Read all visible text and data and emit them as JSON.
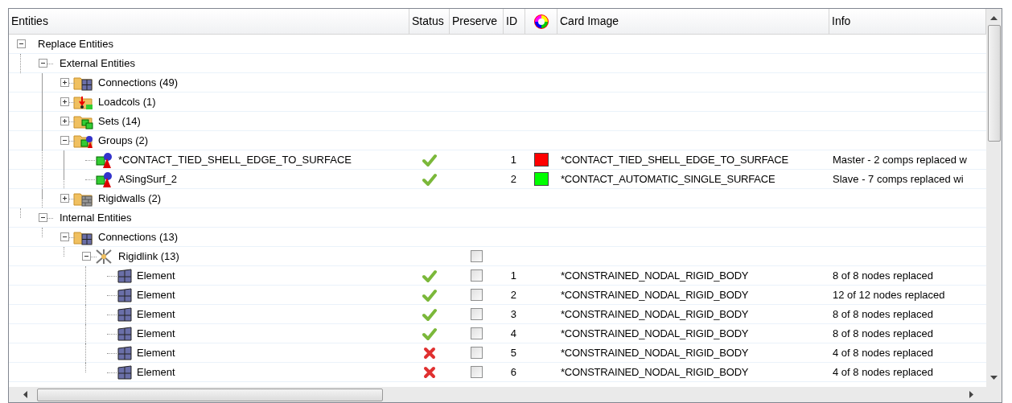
{
  "columns": [
    "Entities",
    "Status",
    "Preserve",
    "ID",
    "Card Image",
    "Info"
  ],
  "tree": [
    {
      "label": "Replace Entities",
      "kind": "plain",
      "expanded": true,
      "children": [
        {
          "label": "External Entities",
          "kind": "plain",
          "expanded": true,
          "children": [
            {
              "label": "Connections (49)",
              "kind": "folder-grid",
              "expanded": false
            },
            {
              "label": "Loadcols (1)",
              "kind": "folder-load",
              "expanded": false
            },
            {
              "label": "Sets (14)",
              "kind": "folder-set",
              "expanded": false
            },
            {
              "label": "Groups (2)",
              "kind": "folder-group",
              "expanded": true,
              "children": [
                {
                  "label": "*CONTACT_TIED_SHELL_EDGE_TO_SURFACE",
                  "kind": "group",
                  "passed": true,
                  "id": "1",
                  "color": "#ff0000",
                  "card_image": "*CONTACT_TIED_SHELL_EDGE_TO_SURFACE",
                  "info": "Master - 2 comps replaced w"
                },
                {
                  "label": "ASingSurf_2",
                  "kind": "group",
                  "passed": true,
                  "id": "2",
                  "color": "#00ff00",
                  "card_image": "*CONTACT_AUTOMATIC_SINGLE_SURFACE",
                  "info": "Slave - 7 comps replaced wi"
                }
              ]
            },
            {
              "label": "Rigidwalls (2)",
              "kind": "folder-wall",
              "expanded": false
            }
          ]
        },
        {
          "label": "Internal Entities",
          "kind": "plain",
          "expanded": true,
          "children": [
            {
              "label": "Connections (13)",
              "kind": "folder-grid",
              "expanded": true,
              "children": [
                {
                  "label": "Rigidlink (13)",
                  "kind": "rigidlink",
                  "expanded": true,
                  "preserve": false,
                  "children": [
                    {
                      "label": "Element",
                      "kind": "element",
                      "passed": true,
                      "preserve": false,
                      "id": "1",
                      "card_image": "*CONSTRAINED_NODAL_RIGID_BODY",
                      "info": "8 of 8 nodes replaced"
                    },
                    {
                      "label": "Element",
                      "kind": "element",
                      "passed": true,
                      "preserve": false,
                      "id": "2",
                      "card_image": "*CONSTRAINED_NODAL_RIGID_BODY",
                      "info": "12 of 12 nodes replaced"
                    },
                    {
                      "label": "Element",
                      "kind": "element",
                      "passed": true,
                      "preserve": false,
                      "id": "3",
                      "card_image": "*CONSTRAINED_NODAL_RIGID_BODY",
                      "info": "8 of 8 nodes replaced"
                    },
                    {
                      "label": "Element",
                      "kind": "element",
                      "passed": true,
                      "preserve": false,
                      "id": "4",
                      "card_image": "*CONSTRAINED_NODAL_RIGID_BODY",
                      "info": "8 of 8 nodes replaced"
                    },
                    {
                      "label": "Element",
                      "kind": "element",
                      "passed": false,
                      "preserve": false,
                      "id": "5",
                      "card_image": "*CONSTRAINED_NODAL_RIGID_BODY",
                      "info": "4 of 8 nodes replaced"
                    },
                    {
                      "label": "Element",
                      "kind": "element",
                      "passed": false,
                      "preserve": false,
                      "id": "6",
                      "card_image": "*CONSTRAINED_NODAL_RIGID_BODY",
                      "info": "4 of 8 nodes replaced"
                    }
                  ]
                }
              ]
            }
          ]
        }
      ]
    }
  ]
}
